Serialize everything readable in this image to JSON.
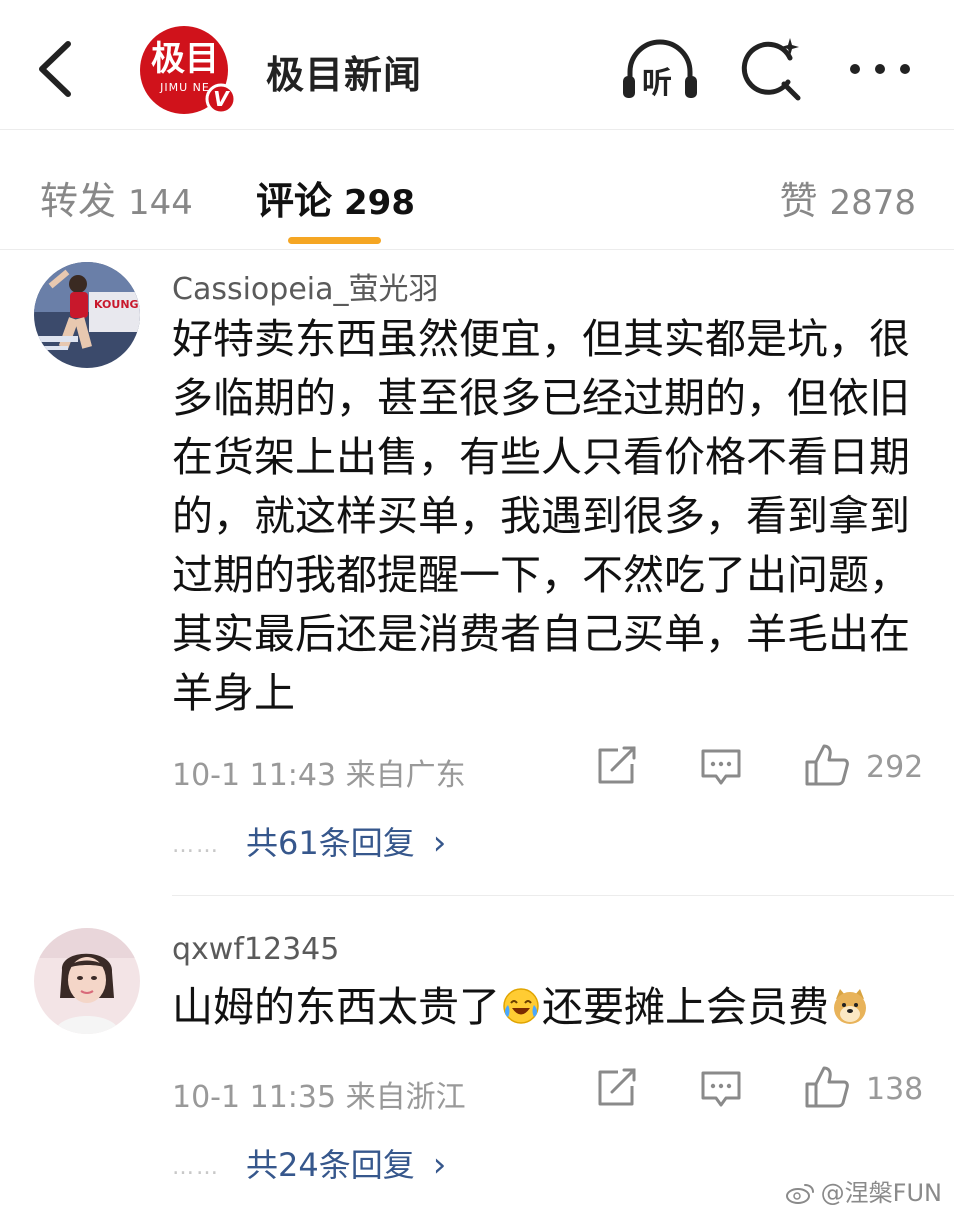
{
  "header": {
    "title": "极目新闻",
    "logo_text": "极目",
    "logo_subtext": "JIMU NE",
    "verified_badge": "V",
    "listen_label": "听",
    "back_icon": "back-arrow-icon",
    "search_icon": "search-icon",
    "more_icon": "more-dots-icon",
    "brand_color": "#d0121b"
  },
  "tabs": [
    {
      "label": "转发",
      "count": "144"
    },
    {
      "label": "评论",
      "count": "298"
    },
    {
      "label": "赞",
      "count": "2878"
    }
  ],
  "tab_accent_color": "#f5a623",
  "comments": [
    {
      "username": "Cassiopeia_萤光羽",
      "text": "好特卖东西虽然便宜，但其实都是坑，很多临期的，甚至很多已经过期的，但依旧在货架上出售，有些人只看价格不看日期的，就这样买单，我遇到很多，看到拿到过期的我都提醒一下，不然吃了出问题，其实最后还是消费者自己买单，羊毛出在羊身上",
      "meta": "10-1 11:43 来自广东",
      "likes": "292",
      "replies_dots": "……",
      "replies": "共61条回复",
      "chevron": "›",
      "avatar_text": "KOUNG"
    },
    {
      "username": "qxwf12345",
      "text_part1": "山姆的东西太贵了",
      "text_part2": "还要摊上会员费",
      "emoji1": "laugh-cry-emoji",
      "emoji2": "doge-emoji",
      "meta": "10-1 11:35 来自浙江",
      "likes": "138",
      "replies_dots": "……",
      "replies": "共24条回复",
      "chevron": "›"
    }
  ],
  "watermark": "@涅槃FUN"
}
